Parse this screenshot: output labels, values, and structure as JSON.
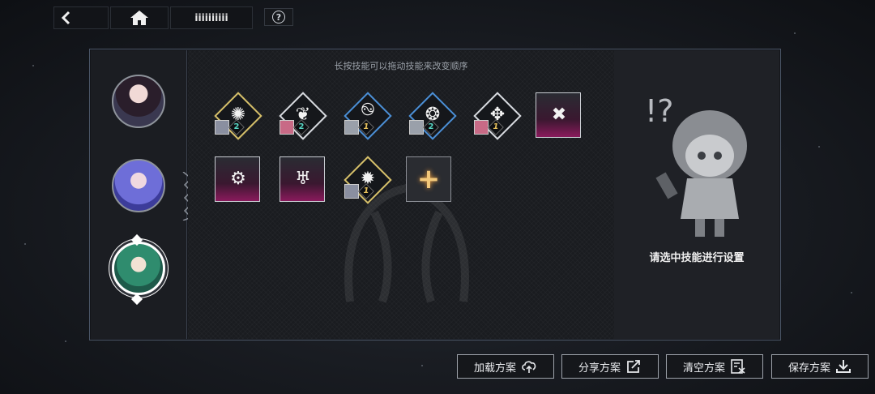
{
  "topbar": {
    "title": "iiiiiiiiii"
  },
  "help": {
    "label": "?"
  },
  "panel": {
    "hint": "长按技能可以拖动技能来改变顺序",
    "info_text": "请选中技能进行设置"
  },
  "characters": [
    {
      "name": "character-1",
      "selected": false
    },
    {
      "name": "character-2",
      "selected": false
    },
    {
      "name": "character-3",
      "selected": true
    }
  ],
  "skills_row1": [
    {
      "frame": "gold-diamond",
      "count": "2",
      "count_color": "teal"
    },
    {
      "frame": "white-diamond",
      "count": "2",
      "count_color": "teal"
    },
    {
      "frame": "blue-diamond",
      "count": "1",
      "count_color": "gold"
    },
    {
      "frame": "blue-diamond",
      "count": "2",
      "count_color": "teal"
    },
    {
      "frame": "white-diamond",
      "count": "1",
      "count_color": "gold"
    },
    {
      "frame": "square"
    }
  ],
  "skills_row2": [
    {
      "frame": "square"
    },
    {
      "frame": "square"
    },
    {
      "frame": "gold-diamond",
      "count": "1",
      "count_color": "gold"
    }
  ],
  "add_skill": {
    "label": "+"
  },
  "buttons": {
    "load": "加载方案",
    "share": "分享方案",
    "clear": "清空方案",
    "save": "保存方案"
  },
  "colors": {
    "accent_gold": "#d6c06a",
    "accent_blue": "#4b8fd6",
    "square_magenta": "#8a1a5c",
    "count_teal": "#58d6c4",
    "count_gold": "#e7c25c"
  }
}
